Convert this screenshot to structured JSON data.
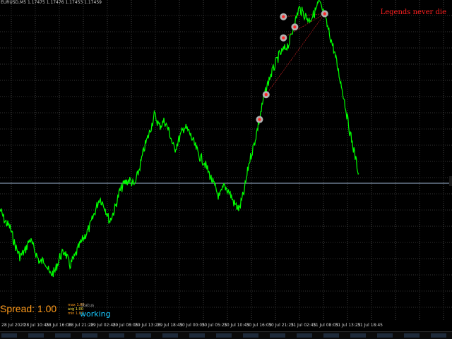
{
  "header": {
    "symbol_info": "EURUSD,M5 1.17475 1.17476 1.17453 1.17459"
  },
  "legend": {
    "text": "Legends never die"
  },
  "hud": {
    "spread_label": "Spread: 1.00",
    "stats": [
      "max 1.00",
      "avg 1.00",
      "min 1.00"
    ],
    "status_label": "Status",
    "status_value": "working"
  },
  "colors": {
    "background": "#000000",
    "price_line": "#00ff00",
    "grid": "#6b6b6b",
    "hline": "#9fb7d6",
    "spread": "#ff9a1a",
    "status": "#18c8ff",
    "legend": "#ff2020",
    "marker_ring": "#b0b0b0",
    "marker_dot": "#ff2a2a",
    "link": "#cc2222"
  },
  "chart_data": {
    "type": "line",
    "x_tick_labels": [
      "28 Jul 2020",
      "28 Jul 10:45",
      "28 Jul 16:05",
      "28 Jul 21:25",
      "29 Jul 02:45",
      "29 Jul 08:05",
      "29 Jul 13:25",
      "29 Jul 18:45",
      "30 Jul 00:05",
      "30 Jul 05:25",
      "30 Jul 10:45",
      "30 Jul 16:05",
      "30 Jul 21:25",
      "31 Jul 02:45",
      "31 Jul 08:05",
      "31 Jul 13:25",
      "31 Jul 18:45"
    ],
    "series": [
      {
        "values": [
          0.34,
          0.3,
          0.28,
          0.22,
          0.18,
          0.2,
          0.24,
          0.2,
          0.16,
          0.17,
          0.12,
          0.13,
          0.18,
          0.2,
          0.15,
          0.18,
          0.22,
          0.25,
          0.28,
          0.33,
          0.38,
          0.35,
          0.3,
          0.34,
          0.4,
          0.43,
          0.44,
          0.42,
          0.48,
          0.55,
          0.6,
          0.66,
          0.62,
          0.64,
          0.6,
          0.54,
          0.58,
          0.62,
          0.6,
          0.56,
          0.52,
          0.5,
          0.46,
          0.42,
          0.38,
          0.42,
          0.4,
          0.36,
          0.34,
          0.4,
          0.5,
          0.56,
          0.64,
          0.72,
          0.78,
          0.82,
          0.86,
          0.88,
          0.9,
          0.96,
          1.02,
          1.0,
          0.98,
          1.0,
          1.04,
          1.0,
          0.94,
          0.88,
          0.8,
          0.72,
          0.62,
          0.54,
          0.46
        ]
      }
    ]
  }
}
